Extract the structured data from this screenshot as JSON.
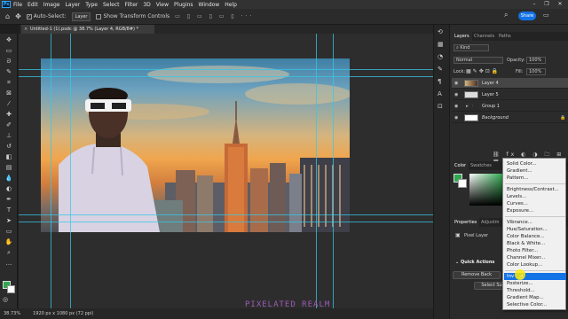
{
  "menubar": {
    "logo": "Ps",
    "items": [
      "File",
      "Edit",
      "Image",
      "Layer",
      "Type",
      "Select",
      "Filter",
      "3D",
      "View",
      "Plugins",
      "Window",
      "Help"
    ],
    "window_controls": [
      "–",
      "❐",
      "✕"
    ]
  },
  "options": {
    "auto_select_label": "Auto-Select:",
    "auto_select_target": "Layer",
    "transform_controls_label": "Show Transform Controls",
    "share_label": "Share"
  },
  "document": {
    "tab_title": "Untitled-1 (1).psdc @ 38.7% (Layer 4, RGB/8#) *",
    "close_glyph": "×"
  },
  "status": {
    "zoom": "38.73%",
    "doc_size": "1920 px x 1080 px (72 ppi)"
  },
  "layers_panel": {
    "tabs": [
      "Layers",
      "Channels",
      "Paths"
    ],
    "filter_kind": "Kind",
    "blend_mode": "Normal",
    "opacity_label": "Opacity:",
    "opacity_value": "100%",
    "lock_label": "Lock:",
    "fill_label": "Fill:",
    "fill_value": "100%",
    "layers": [
      {
        "name": "Layer 4",
        "selected": true
      },
      {
        "name": "Layer 5",
        "selected": false
      },
      {
        "name": "Group 1",
        "selected": false
      },
      {
        "name": "Background",
        "selected": false
      }
    ]
  },
  "color_panel": {
    "tabs": [
      "Color",
      "Swatches"
    ],
    "fg_color": "#2fa84f"
  },
  "properties_panel": {
    "tabs": [
      "Properties",
      "Adjustm"
    ],
    "layer_type": "Pixel Layer"
  },
  "quick_actions": {
    "title": "Quick Actions",
    "remove_background": "Remove Back",
    "select_subject": "Select Su"
  },
  "adjustment_menu": {
    "items": [
      "Solid Color...",
      "Gradient...",
      "Pattern...",
      "Brightness/Contrast...",
      "Levels...",
      "Curves...",
      "Exposure...",
      "Vibrance...",
      "Hue/Saturation...",
      "Color Balance...",
      "Black & White...",
      "Photo Filter...",
      "Channel Mixer...",
      "Color Lookup...",
      "Invert",
      "Posterize...",
      "Threshold...",
      "Gradient Map...",
      "Selective Color..."
    ],
    "highlighted": "Invert",
    "visible_highlighted_text": "Inv"
  },
  "watermark": "PIXELATED REALM",
  "colors": {
    "accent": "#1473e6",
    "guide": "#35c8e8",
    "watermark": "#9b5cb2"
  }
}
